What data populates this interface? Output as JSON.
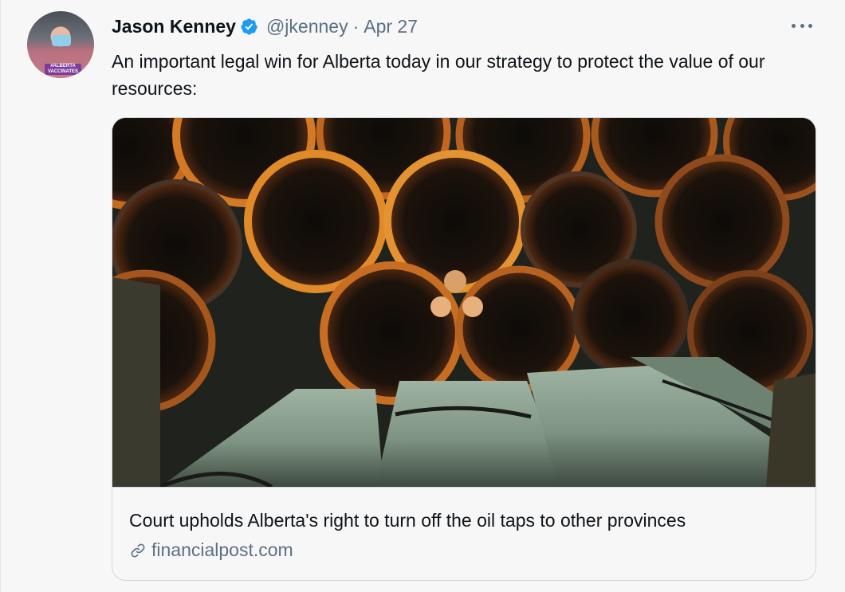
{
  "tweet": {
    "author_name": "Jason Kenney",
    "handle": "@jkenney",
    "separator": "·",
    "date": "Apr 27",
    "text": "An important legal win for Alberta today in our strategy to protect the value of our resources:",
    "avatar_badge": "#ALBERTA VACCINATES",
    "verified_icon": "verified-badge-icon",
    "more_icon": "more-options-icon"
  },
  "card": {
    "title": "Court upholds Alberta's right to turn off the oil taps to other provinces",
    "domain": "financialpost.com",
    "image_subject": "stacked pipeline pipes",
    "link_icon": "link-icon"
  },
  "colors": {
    "verified_blue": "#1d9bf0",
    "secondary_text": "#5b7083",
    "primary_text": "#0f1419",
    "border": "#cfd9de"
  }
}
